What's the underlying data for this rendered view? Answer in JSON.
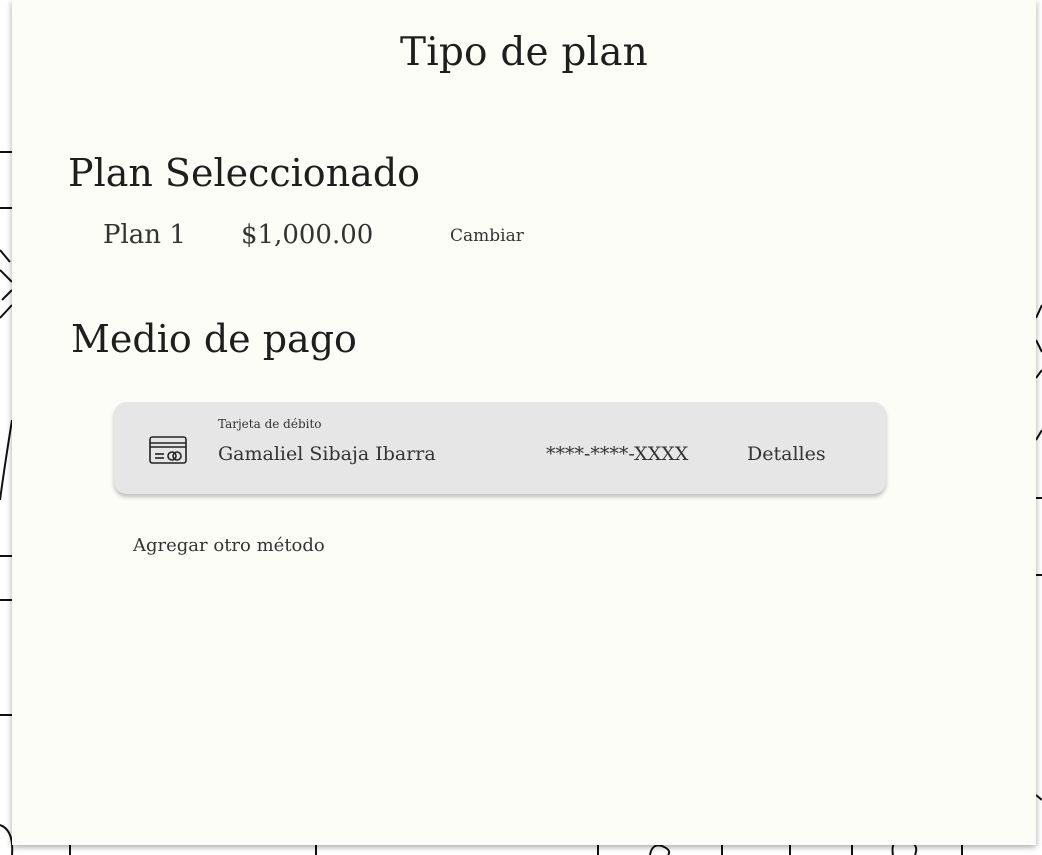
{
  "page": {
    "title": "Tipo de plan"
  },
  "plan_section": {
    "title": "Plan Seleccionado",
    "plan_name": "Plan 1",
    "plan_price": "$1,000.00",
    "change_label": "Cambiar"
  },
  "payment_section": {
    "title": "Medio de pago",
    "methods": [
      {
        "type": "Tarjeta de débito",
        "holder": "Gamaliel Sibaja Ibarra",
        "number": "****-****-XXXX",
        "details_label": "Detalles",
        "icon": "credit-card-icon"
      }
    ],
    "add_label": "Agregar otro método"
  },
  "colors": {
    "panel_background": "#fdfdf8",
    "card_background": "#e6e6e6",
    "text": "#222222"
  }
}
